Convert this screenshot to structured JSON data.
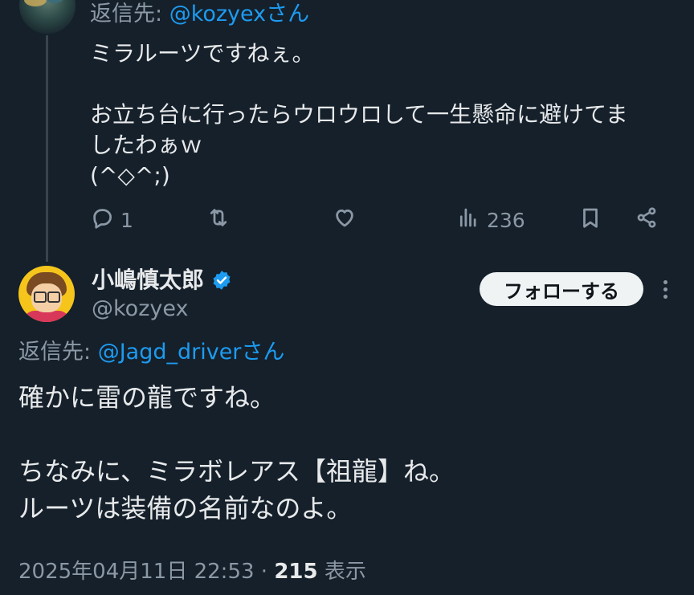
{
  "parent_tweet": {
    "reply_prefix": "返信先: ",
    "reply_mention": "@kozyex",
    "reply_suffix": "さん",
    "lines": [
      "ミラルーツですねぇ。",
      "",
      "お立ち台に行ったらウロウロして一生懸命に避けてま",
      "したわぁｗ",
      "(^◇^;)"
    ],
    "actions": {
      "reply_count": "1",
      "views_count": "236"
    }
  },
  "tweet": {
    "display_name": "小嶋慎太郎",
    "handle": "@kozyex",
    "follow_label": "フォローする",
    "reply_prefix": "返信先: ",
    "reply_mention": "@Jagd_driver",
    "reply_suffix": "さん",
    "lines": [
      "確かに雷の龍ですね。",
      "",
      "ちなみに、ミラボレアス【祖龍】ね。",
      "ルーツは装備の名前なのよ。"
    ],
    "timestamp": "2025年04月11日 22:53",
    "separator": " · ",
    "views": "215",
    "views_label": " 表示"
  },
  "icons": {
    "reply": "reply-icon",
    "retweet": "retweet-icon",
    "like": "like-icon",
    "views": "views-icon",
    "bookmark": "bookmark-icon",
    "share": "share-icon",
    "verified": "verified-badge-icon",
    "more": "more-icon"
  },
  "colors": {
    "background": "#15202b",
    "text": "#e7e9ea",
    "secondary": "#8b98a5",
    "link": "#1d9bf0",
    "follow_button_bg": "#eff3f4"
  }
}
